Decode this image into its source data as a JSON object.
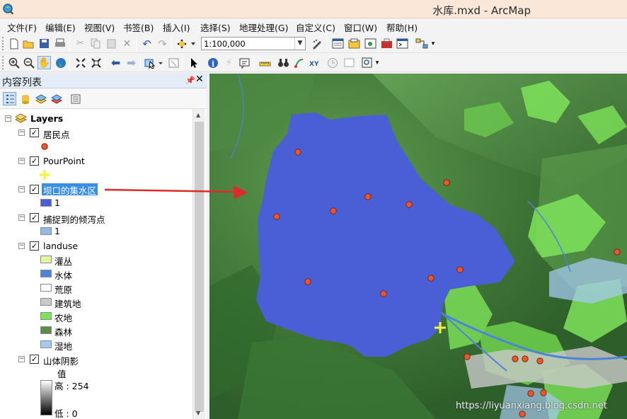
{
  "window": {
    "title": "水库.mxd - ArcMap"
  },
  "menu": [
    "文件(F)",
    "编辑(E)",
    "视图(V)",
    "书签(B)",
    "插入(I)",
    "选择(S)",
    "地理处理(G)",
    "自定义(C)",
    "窗口(W)",
    "帮助(H)"
  ],
  "toolbar": {
    "scale_value": "1:100,000"
  },
  "toc": {
    "title": "内容列表",
    "root_label": "Layers",
    "layers": {
      "residents": {
        "name": "居民点"
      },
      "pourpoint": {
        "name": "PourPoint"
      },
      "catchment": {
        "name": "坝口的集水区",
        "value_label": "1"
      },
      "snapped": {
        "name": "捕捉到的倾泻点",
        "value_label": "1"
      },
      "landuse": {
        "name": "landuse",
        "classes": [
          "灌丛",
          "水体",
          "荒原",
          "建筑地",
          "农地",
          "森林",
          "湿地"
        ]
      },
      "hillshade": {
        "name": "山体阴影",
        "value_heading": "值",
        "high": "高 : 254",
        "low": "低 : 0"
      }
    }
  },
  "colors": {
    "catchment": "#4a5fd6",
    "residents_point": "#e8572f",
    "pourpoint": "#f5f535",
    "selection": "#3a8ee6",
    "arrow": "#e02a2a",
    "landuse": [
      "#e2f7a6",
      "#4f82d9",
      "#ffffff",
      "#c9c9c9",
      "#7ee35a",
      "#5b8c46",
      "#a5c8ee"
    ]
  },
  "map": {
    "watermark": "https://liyuanxiang.blog.csdn.net"
  }
}
